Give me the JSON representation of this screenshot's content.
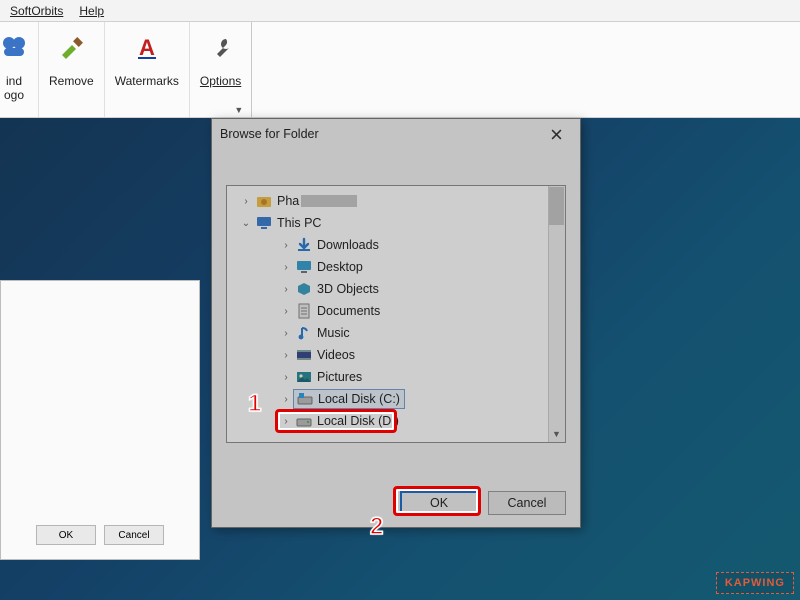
{
  "menubar": {
    "items": [
      {
        "label": "SoftOrbits"
      },
      {
        "label": "Help"
      }
    ]
  },
  "ribbon": {
    "find_logo": {
      "line1": "ind",
      "line2": "ogo"
    },
    "remove": {
      "label": "Remove"
    },
    "watermarks": {
      "label": "Watermarks"
    },
    "options": {
      "label": "Options"
    }
  },
  "bg_dialog": {
    "ok": "OK",
    "cancel": "Cancel"
  },
  "dialog": {
    "title": "Browse for Folder",
    "ok": "OK",
    "cancel": "Cancel",
    "tree": {
      "user_prefix": "Pha",
      "this_pc": "This PC",
      "items": [
        "Downloads",
        "Desktop",
        "3D Objects",
        "Documents",
        "Music",
        "Videos",
        "Pictures",
        "Local Disk (C:)",
        "Local Disk (D:)"
      ]
    }
  },
  "annotations": {
    "one": "1",
    "two": "2"
  },
  "watermark": "KAPWING"
}
